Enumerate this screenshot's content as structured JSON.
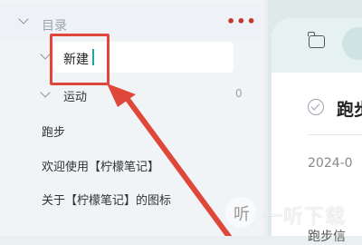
{
  "sidebar": {
    "directory_label": "目录",
    "more_label": "•••",
    "new_folder_input_value": "新建",
    "folder": {
      "label": "运动",
      "count": "0"
    },
    "notes": [
      "跑步",
      "欢迎使用【柠檬笔记】",
      "关于【柠檬笔记】的图标"
    ]
  },
  "detail": {
    "title": "跑步",
    "date": "2024-0",
    "bottom_text": "跑步信"
  },
  "watermark": {
    "icon_glyph": "听",
    "text": "一听下载"
  },
  "colors": {
    "highlight": "#e0473b",
    "accent": "#1aa7a7"
  }
}
